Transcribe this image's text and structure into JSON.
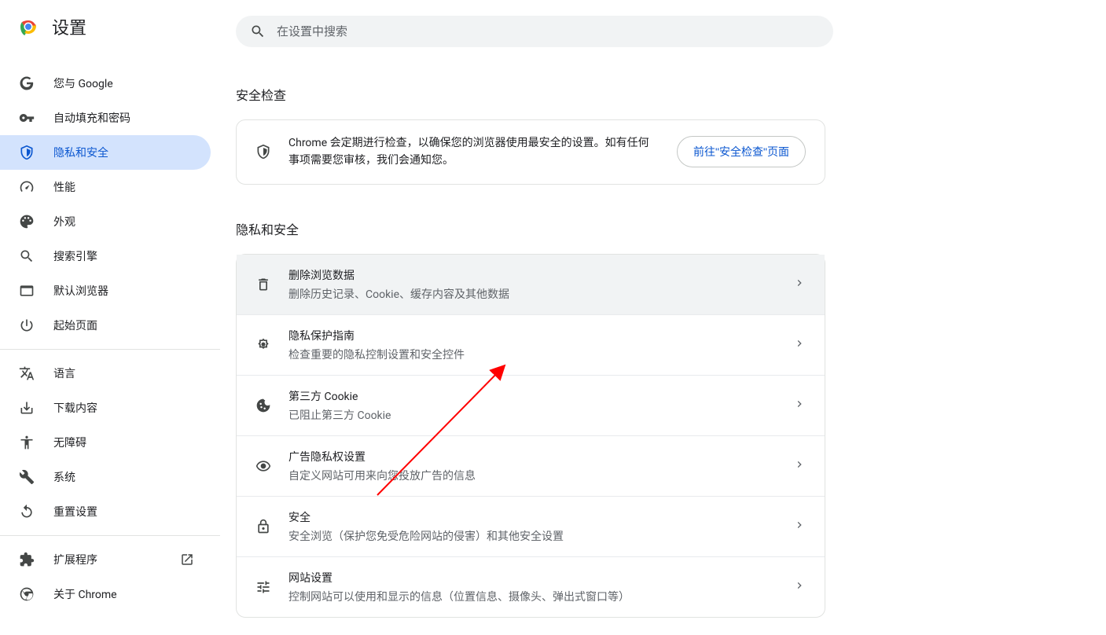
{
  "header": {
    "title": "设置"
  },
  "search": {
    "placeholder": "在设置中搜索"
  },
  "sidebar": {
    "items": [
      {
        "label": "您与 Google"
      },
      {
        "label": "自动填充和密码"
      },
      {
        "label": "隐私和安全"
      },
      {
        "label": "性能"
      },
      {
        "label": "外观"
      },
      {
        "label": "搜索引擎"
      },
      {
        "label": "默认浏览器"
      },
      {
        "label": "起始页面"
      }
    ],
    "items2": [
      {
        "label": "语言"
      },
      {
        "label": "下载内容"
      },
      {
        "label": "无障碍"
      },
      {
        "label": "系统"
      },
      {
        "label": "重置设置"
      }
    ],
    "items3": [
      {
        "label": "扩展程序"
      },
      {
        "label": "关于 Chrome"
      }
    ]
  },
  "safety": {
    "section_title": "安全检查",
    "description": "Chrome 会定期进行检查，以确保您的浏览器使用最安全的设置。如有任何事项需要您审核，我们会通知您。",
    "button": "前往\"安全检查\"页面"
  },
  "privacy": {
    "section_title": "隐私和安全",
    "rows": [
      {
        "title": "删除浏览数据",
        "sub": "删除历史记录、Cookie、缓存内容及其他数据"
      },
      {
        "title": "隐私保护指南",
        "sub": "检查重要的隐私控制设置和安全控件"
      },
      {
        "title": "第三方 Cookie",
        "sub": "已阻止第三方 Cookie"
      },
      {
        "title": "广告隐私权设置",
        "sub": "自定义网站可用来向您投放广告的信息"
      },
      {
        "title": "安全",
        "sub": "安全浏览（保护您免受危险网站的侵害）和其他安全设置"
      },
      {
        "title": "网站设置",
        "sub": "控制网站可以使用和显示的信息（位置信息、摄像头、弹出式窗口等）"
      }
    ]
  }
}
